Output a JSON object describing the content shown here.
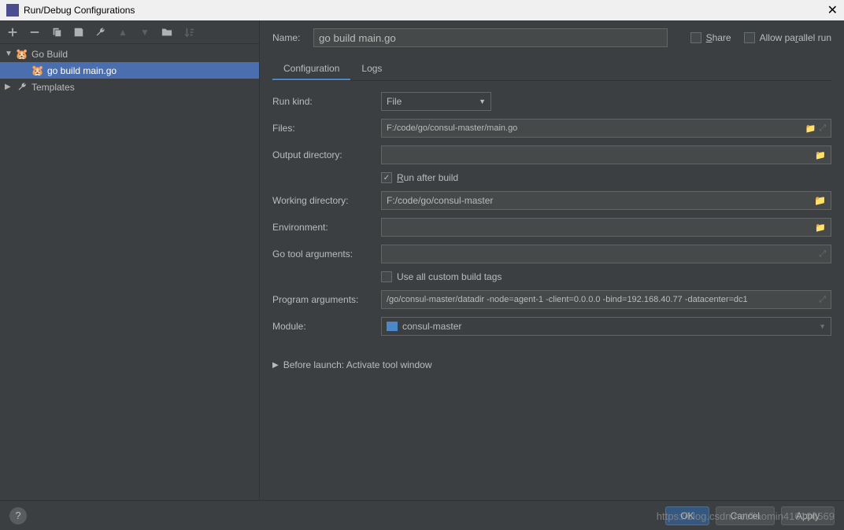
{
  "title": "Run/Debug Configurations",
  "sidebar": {
    "items": [
      {
        "label": "Go Build",
        "expanded": true
      },
      {
        "label": "go build main.go",
        "selected": true
      },
      {
        "label": "Templates",
        "expanded": false
      }
    ]
  },
  "header": {
    "name_label": "Name:",
    "name_value": "go build main.go",
    "share_label": "Share",
    "allow_parallel_label": "Allow parallel run"
  },
  "tabs": [
    {
      "label": "Configuration",
      "active": true
    },
    {
      "label": "Logs",
      "active": false
    }
  ],
  "form": {
    "run_kind_label": "Run kind:",
    "run_kind_value": "File",
    "files_label": "Files:",
    "files_value": "F:/code/go/consul-master/main.go",
    "output_dir_label": "Output directory:",
    "output_dir_value": "",
    "run_after_build_label": "Run after build",
    "run_after_build_checked": true,
    "working_dir_label": "Working directory:",
    "working_dir_value": "F:/code/go/consul-master",
    "environment_label": "Environment:",
    "environment_value": "",
    "go_tool_args_label": "Go tool arguments:",
    "go_tool_args_value": "",
    "use_custom_tags_label": "Use all custom build tags",
    "use_custom_tags_checked": false,
    "program_args_label": "Program arguments:",
    "program_args_value": "/go/consul-master/datadir -node=agent-1 -client=0.0.0.0 -bind=192.168.40.77 -datacenter=dc1",
    "module_label": "Module:",
    "module_value": "consul-master"
  },
  "before_launch": "Before launch: Activate tool window",
  "buttons": {
    "ok": "OK",
    "cancel": "Cancel",
    "apply": "Apply"
  },
  "watermark": "https://blog.csdn.net/liaomin416100569"
}
